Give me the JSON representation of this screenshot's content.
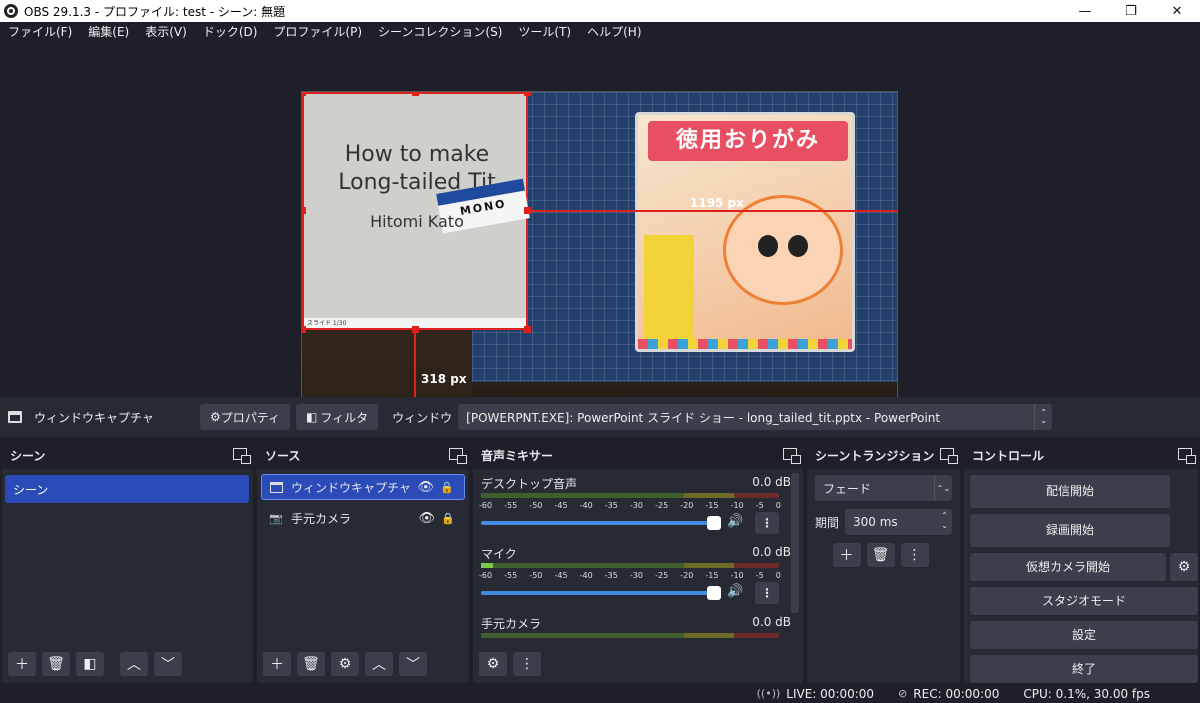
{
  "window": {
    "title": "OBS 29.1.3 - プロファイル: test - シーン: 無題",
    "controls": {
      "minimize": "—",
      "maximize": "❐",
      "close": "✕"
    }
  },
  "menu": [
    "ファイル(F)",
    "編集(E)",
    "表示(V)",
    "ドック(D)",
    "プロファイル(P)",
    "シーンコレクション(S)",
    "ツール(T)",
    "ヘルプ(H)"
  ],
  "preview": {
    "slide_title_1": "How to make",
    "slide_title_2": "Long-tailed Tit",
    "slide_author": "Hitomi Kato",
    "eraser_label": "MONO",
    "slide_bar": "スライド 1/30",
    "width_label": "1195 px",
    "height_label": "318 px"
  },
  "properties_bar": {
    "source_name": "ウィンドウキャプチャ",
    "properties_label": "プロパティ",
    "filters_label": "フィルタ",
    "window_label": "ウィンドウ",
    "window_value": "[POWERPNT.EXE]: PowerPoint スライド ショー  -  long_tailed_tit.pptx - PowerPoint"
  },
  "scenes_dock": {
    "title": "シーン",
    "items": [
      "シーン"
    ]
  },
  "sources_dock": {
    "title": "ソース",
    "items": [
      {
        "name": "ウィンドウキャプチャ",
        "icon": "window-icon",
        "selected": true
      },
      {
        "name": "手元カメラ",
        "icon": "camera-icon",
        "selected": false
      }
    ]
  },
  "mixer_dock": {
    "title": "音声ミキサー",
    "ticks": [
      "-60",
      "-55",
      "-50",
      "-45",
      "-40",
      "-35",
      "-30",
      "-25",
      "-20",
      "-15",
      "-10",
      "-5",
      "0"
    ],
    "channels": [
      {
        "name": "デスクトップ音声",
        "db": "0.0 dB"
      },
      {
        "name": "マイク",
        "db": "0.0 dB"
      },
      {
        "name": "手元カメラ",
        "db": "0.0 dB"
      }
    ]
  },
  "transitions_dock": {
    "title": "シーントランジション",
    "transition": "フェード",
    "duration_label": "期間",
    "duration_value": "300 ms"
  },
  "controls_dock": {
    "title": "コントロール",
    "start_streaming": "配信開始",
    "start_recording": "録画開始",
    "start_virtual_cam": "仮想カメラ開始",
    "studio_mode": "スタジオモード",
    "settings": "設定",
    "exit": "終了"
  },
  "status": {
    "live": "LIVE: 00:00:00",
    "rec": "REC: 00:00:00",
    "cpu": "CPU: 0.1%, 30.00 fps"
  },
  "colors": {
    "accent": "#2b4bb8",
    "selection": "#e0201f",
    "background": "#1e1f29",
    "dock": "#272a33"
  }
}
